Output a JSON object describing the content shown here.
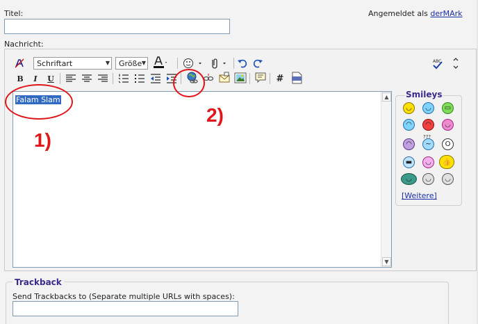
{
  "labels": {
    "title": "Titel:",
    "logged_in_prefix": "Angemeldet als ",
    "logged_in_user": "derMArk",
    "message": "Nachricht:"
  },
  "toolbar": {
    "font_select": "Schriftart",
    "size_select": "Größe",
    "bold": "B",
    "italic": "I",
    "underline": "U",
    "hash": "#",
    "spellcheck": "ABC"
  },
  "editor": {
    "selected_text": "Falam Slam"
  },
  "smileys": {
    "title": "Smileys",
    "more_link": "[Weitere]",
    "icon_confused_text": "???"
  },
  "trackback": {
    "title": "Trackback",
    "description": "Send Trackbacks to (Separate multiple URLs with spaces):"
  },
  "annotations": {
    "one": "1)",
    "two": "2)"
  },
  "colors": {
    "annotation": "#e0161b",
    "selection": "#316ac5",
    "link": "#1b2fa8",
    "heading": "#3a2c8c"
  }
}
